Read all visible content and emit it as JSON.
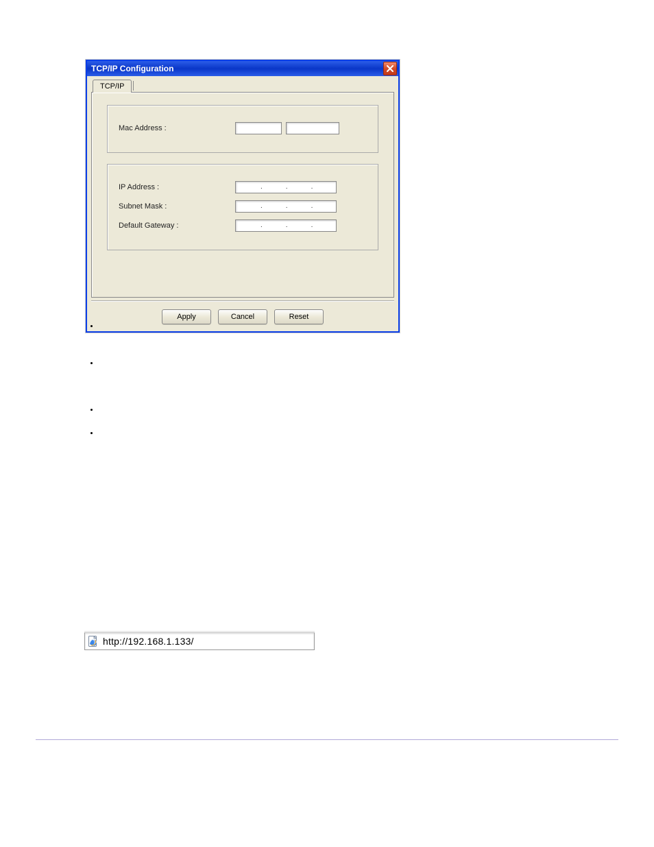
{
  "dialog": {
    "title": "TCP/IP Configuration",
    "tab_label": "TCP/IP",
    "group_mac": {
      "label": "Mac Address :",
      "value_a": "",
      "value_b": ""
    },
    "group_ip": {
      "ip_label": "IP Address :",
      "subnet_label": "Subnet Mask :",
      "gateway_label": "Default Gateway :",
      "ip_value": [
        "",
        "",
        "",
        ""
      ],
      "subnet_value": [
        "",
        "",
        "",
        ""
      ],
      "gateway_value": [
        "",
        "",
        "",
        ""
      ]
    },
    "buttons": {
      "apply": "Apply",
      "cancel": "Cancel",
      "reset": "Reset"
    }
  },
  "addressbar": {
    "url": "http://192.168.1.133/"
  }
}
